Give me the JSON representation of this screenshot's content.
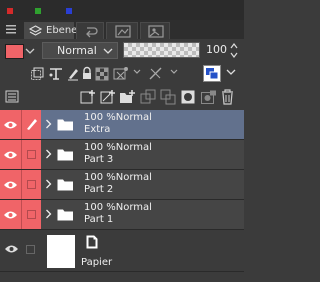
{
  "colors": {
    "accent_red": "#f06468",
    "selected_row": "#62718d",
    "dot_red": "#d42a2a",
    "dot_green": "#2fa12f",
    "dot_blue": "#2a3fd4"
  },
  "tabs": [
    {
      "id": "menu",
      "label": "",
      "icon": "list-menu-icon"
    },
    {
      "id": "layers",
      "label": "Ebene",
      "icon": "layers-icon"
    },
    {
      "id": "history",
      "label": "",
      "icon": "history-icon"
    },
    {
      "id": "navigator",
      "label": "",
      "icon": "navigator-icon"
    },
    {
      "id": "subview",
      "label": "",
      "icon": "subview-icon"
    }
  ],
  "properties": {
    "blend_mode": "Normal",
    "opacity": "100"
  },
  "layers": [
    {
      "opacity_mode": "100 %Normal",
      "name": "Extra",
      "selected": true,
      "editing": true
    },
    {
      "opacity_mode": "100 %Normal",
      "name": "Part 3",
      "selected": false,
      "editing": false
    },
    {
      "opacity_mode": "100 %Normal",
      "name": "Part 2",
      "selected": false,
      "editing": false
    },
    {
      "opacity_mode": "100 %Normal",
      "name": "Part 1",
      "selected": false,
      "editing": false
    }
  ],
  "paper": {
    "name": "Papier"
  }
}
